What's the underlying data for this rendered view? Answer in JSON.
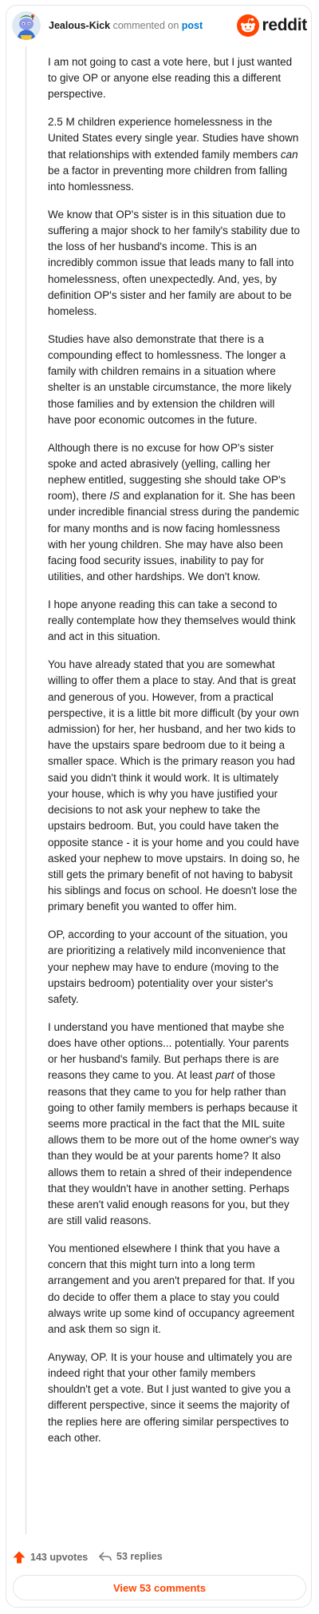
{
  "header": {
    "username": "Jealous-Kick",
    "verb": "commented on",
    "link": "post",
    "brand": "reddit"
  },
  "comment": {
    "paragraphs": [
      [
        {
          "t": "I am not going to cast a vote here, but I just wanted to give OP or anyone else reading this a different perspective."
        }
      ],
      [
        {
          "t": "2.5 M children experience homelessness in the United States every single year. Studies have shown that relationships with extended family members "
        },
        {
          "t": "can",
          "i": true
        },
        {
          "t": " be a factor in preventing more children from falling into homlessness."
        }
      ],
      [
        {
          "t": "We know that OP's sister is in this situation due to suffering a major shock to her family's stability due to the loss of her husband's income. This is an incredibly common issue that leads many to fall into homelessness, often unexpectedly. And, yes, by definition OP's sister and her family are about to be homeless."
        }
      ],
      [
        {
          "t": "Studies have also demonstrate that there is a compounding effect to homlessness. The longer a family with children remains in a situation where shelter is an unstable circumstance, the more likely those families and by extension the children will have poor economic outcomes in the future."
        }
      ],
      [
        {
          "t": "Although there is no excuse for how OP's sister spoke and acted abrasively (yelling, calling her nephew entitled, suggesting she should take OP's room), there "
        },
        {
          "t": "IS",
          "i": true
        },
        {
          "t": " and explanation for it. She has been under incredible financial stress during the pandemic for many months and is now facing homlessness with her young children. She may have also been facing food security issues, inability to pay for utilities, and other hardships. We don't know."
        }
      ],
      [
        {
          "t": "I hope anyone reading this can take a second to really contemplate how they themselves would think and act in this situation."
        }
      ],
      [
        {
          "t": "You have already stated that you are somewhat willing to offer them a place to stay. And that is great and generous of you. However, from a practical perspective, it is a little bit more difficult (by your own admission) for her, her husband, and her two kids to have the upstairs spare bedroom due to it being a smaller space. Which is the primary reason you had said you didn't think it would work. It is ultimately your house, which is why you have justified your decisions to not ask your nephew to take the upstairs bedroom. But, you could have taken the opposite stance - it is your home and you could have asked your nephew to move upstairs. In doing so, he still gets the primary benefit of not having to babysit his siblings and focus on school. He doesn't lose the primary benefit you wanted to offer him."
        }
      ],
      [
        {
          "t": "OP, according to your account of the situation, you are prioritizing a relatively mild inconvenience that your nephew may have to endure (moving to the upstairs bedroom) potentiality over your sister's safety."
        }
      ],
      [
        {
          "t": "I understand you have mentioned that maybe she does have other options... potentially. Your parents or her husband's family. But perhaps there is are reasons they came to you. At least "
        },
        {
          "t": "part",
          "i": true
        },
        {
          "t": " of those reasons that they came to you for help rather than going to other family members is perhaps because it seems more practical in the fact that the MIL suite allows them to be more out of the home owner's way than they would be at your parents home? It also allows them to retain a shred of their independence that they wouldn't have in another setting. Perhaps these aren't valid enough reasons for you, but they are still valid reasons."
        }
      ],
      [
        {
          "t": "You mentioned elsewhere I think that you have a concern that this might turn into a long term arrangement and you aren't prepared for that. If you do decide to offer them a place to stay you could always write up some kind of occupancy agreement and ask them so sign it."
        }
      ],
      [
        {
          "t": "Anyway, OP. It is your house and ultimately you are indeed right that your other family members shouldn't get a vote. But I just wanted to give you a different perspective, since it seems the majority of the replies here are offering similar perspectives to each other."
        }
      ]
    ]
  },
  "footer": {
    "upvotes": "143 upvotes",
    "replies": "53 replies",
    "view_button": "View 53 comments"
  },
  "colors": {
    "brand": "#ff4500",
    "link": "#0079d3",
    "muted": "#7c7c7c"
  },
  "icons": {
    "avatar": "snoo-avatar",
    "brand": "reddit-logo-icon",
    "upvote": "upvote-arrow-icon",
    "reply": "reply-arrow-icon"
  }
}
